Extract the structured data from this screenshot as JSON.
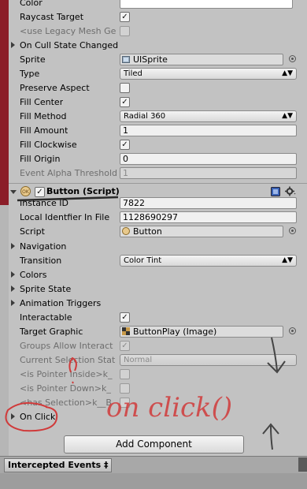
{
  "material_rows": [
    {
      "key": "color",
      "label": "Color",
      "kind": "color",
      "value": ""
    },
    {
      "key": "raycast",
      "label": "Raycast Target",
      "kind": "check",
      "checked": "✓"
    },
    {
      "key": "legacy",
      "label": "<use Legacy Mesh Ge",
      "kind": "check",
      "checked": "",
      "dim": true
    }
  ],
  "on_cull": "On Cull State Changed",
  "image": {
    "sprite_label": "Sprite",
    "sprite_value": "UISprite",
    "type_label": "Type",
    "type_value": "Tiled",
    "preserve_label": "Preserve Aspect",
    "fill_center_label": "Fill Center",
    "fill_method_label": "Fill Method",
    "fill_method_value": "Radial 360",
    "fill_amount_label": "Fill Amount",
    "fill_amount_value": "1",
    "fill_clockwise_label": "Fill Clockwise",
    "fill_origin_label": "Fill Origin",
    "fill_origin_value": "0",
    "alpha_label": "Event Alpha Threshold",
    "alpha_value": "1"
  },
  "button_component": {
    "title": "Button (Script)",
    "instance_label": "Instance ID",
    "instance_value": "7822",
    "local_label": "Local Identfier In File",
    "local_value": "1128690297",
    "script_label": "Script",
    "script_value": "Button",
    "navigation_label": "Navigation",
    "transition_label": "Transition",
    "transition_value": "Color Tint",
    "colors_label": "Colors",
    "sprite_state_label": "Sprite State",
    "anim_label": "Animation Triggers",
    "interactable_label": "Interactable",
    "target_label": "Target Graphic",
    "target_value": "ButtonPlay (Image)",
    "groups_label": "Groups Allow Interact",
    "selection_label": "Current Selection Stat",
    "selection_value": "Normal",
    "pointer_inside_label": "<is Pointer Inside>k_",
    "pointer_down_label": "<is Pointer Down>k_",
    "has_selection_label": "<has Selection>k__B",
    "onclick_label": "On Click"
  },
  "add_component": "Add Component",
  "intercepted_events": "Intercepted Events ‡",
  "annotation_text": "on click()",
  "check_mark": "✓",
  "dropdown_arrow": "▲▼",
  "colors": {
    "accent_red": "#d03a3a",
    "panel_bg": "#c2c2c2",
    "header_check": "#3a62b5"
  }
}
